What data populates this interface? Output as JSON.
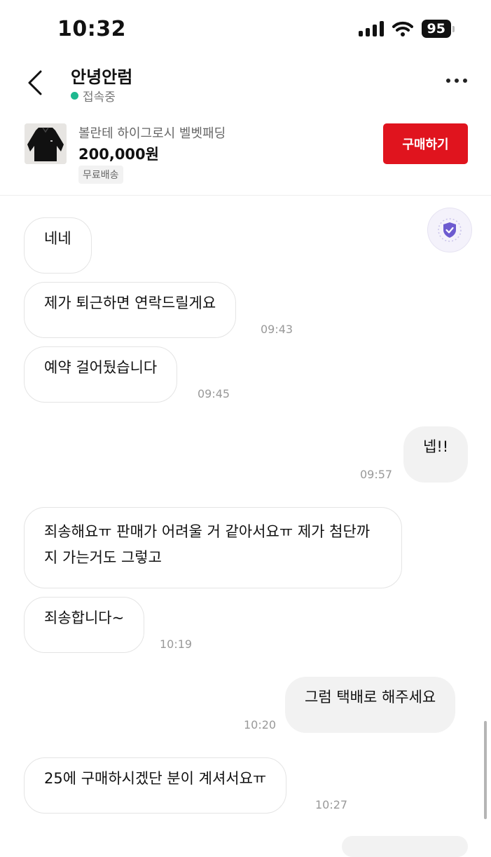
{
  "status_bar": {
    "time": "10:32",
    "battery": "95"
  },
  "header": {
    "user_name": "안녕안럼",
    "status": "접속중"
  },
  "product": {
    "name": "볼란테 하이그로시 벨벳패딩",
    "price": "200,000원",
    "shipping": "무료배송",
    "buy_label": "구매하기"
  },
  "messages": [
    {
      "sender": "other",
      "text": "네네",
      "time": ""
    },
    {
      "sender": "other",
      "text": "제가 퇴근하면 연락드릴게요",
      "time": "09:43"
    },
    {
      "sender": "other",
      "text": "예약 걸어뒀습니다",
      "time": "09:45"
    },
    {
      "sender": "me",
      "text": "넵!!",
      "time": "09:57"
    },
    {
      "sender": "other",
      "text": "죄송해요ㅠ 판매가 어려울 거 같아서요ㅠ 제가 첨단까지 가는거도 그렇고",
      "time": ""
    },
    {
      "sender": "other",
      "text": "죄송합니다~",
      "time": "10:19"
    },
    {
      "sender": "me",
      "text": "그럼 택배로 해주세요",
      "time": "10:20"
    },
    {
      "sender": "other",
      "text": "25에 구매하시겠단 분이 계셔서요ㅠ",
      "time": "10:27"
    }
  ],
  "icons": {
    "back": "chevron-left-icon",
    "more": "more-dots-icon",
    "shield": "shield-check-icon",
    "signal": "cellular-signal-icon",
    "wifi": "wifi-icon",
    "battery": "battery-icon"
  },
  "colors": {
    "accent": "#e0141e",
    "online": "#1db88f",
    "shield": "#6d5bd0"
  }
}
